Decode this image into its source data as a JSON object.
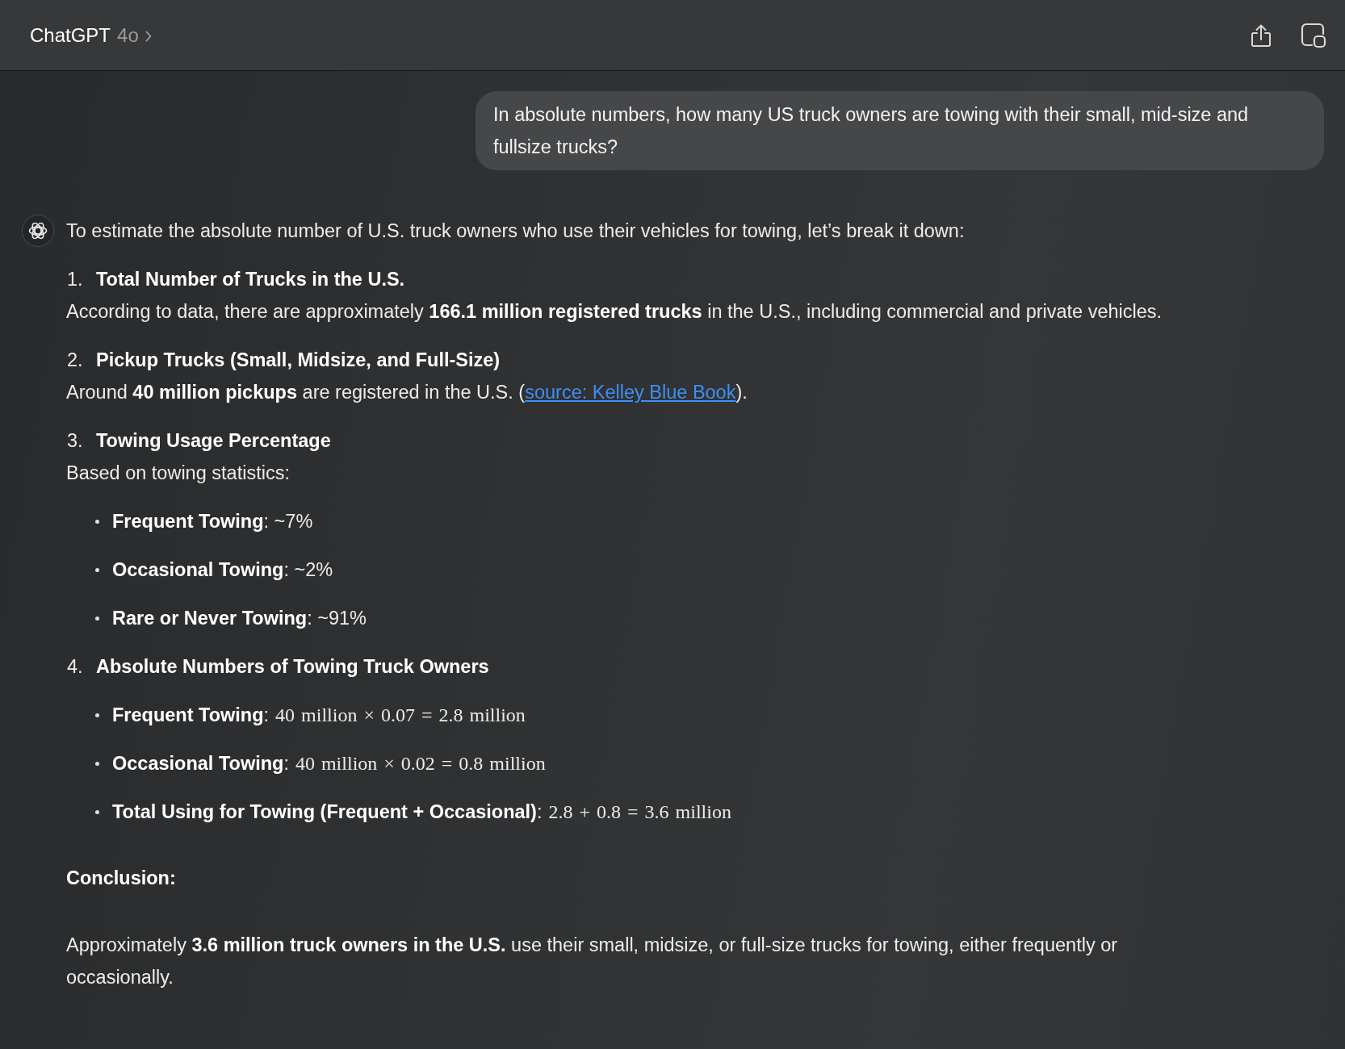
{
  "header": {
    "title": "ChatGPT",
    "model": "4o"
  },
  "user_message": {
    "text": "In absolute numbers, how many US truck owners are towing with their small, mid-size and fullsize trucks?"
  },
  "assistant_message": {
    "intro": "To estimate the absolute number of U.S. truck owners who use their vehicles for towing, let’s break it down:",
    "sections": [
      {
        "number": "1.",
        "heading": "Total Number of Trucks in the U.S.",
        "body": [
          {
            "kind": "text",
            "text": "According to data, there are approximately **166.1 million registered trucks** in the U.S., including commercial and private vehicles."
          }
        ]
      },
      {
        "number": "2.",
        "heading": "Pickup Trucks (Small, Midsize, and Full-Size)",
        "body": [
          {
            "kind": "text",
            "text": "Around **40 million pickups** are registered in the U.S. ("
          },
          {
            "kind": "link",
            "text": "source: Kelley Blue Book"
          },
          {
            "kind": "text",
            "text": ")."
          }
        ]
      },
      {
        "number": "3.",
        "heading": "Towing Usage Percentage",
        "body": [
          {
            "kind": "text",
            "text": "Based on towing statistics:"
          }
        ],
        "bullets": [
          {
            "text": "**Frequent Towing**: ~7%"
          },
          {
            "text": "**Occasional Towing**: ~2%"
          },
          {
            "text": "**Rare or Never Towing**: ~91%"
          }
        ]
      },
      {
        "number": "4.",
        "heading": "Absolute Numbers of Towing Truck Owners",
        "bullets": [
          {
            "text": "**Frequent Towing**:",
            "math": "40 million × 0.07 = 2.8 million"
          },
          {
            "text": "**Occasional Towing**:",
            "math": "40 million × 0.02 = 0.8 million"
          },
          {
            "text": "**Total Using for Towing (Frequent + Occasional)**:",
            "math": "2.8 + 0.8 = 3.6 million"
          }
        ]
      }
    ],
    "conclusion_heading": "Conclusion:",
    "conclusion": "Approximately **3.6 million truck owners in the U.S.** use their small, midsize, or full-size trucks for towing, either frequently or occasionally."
  }
}
